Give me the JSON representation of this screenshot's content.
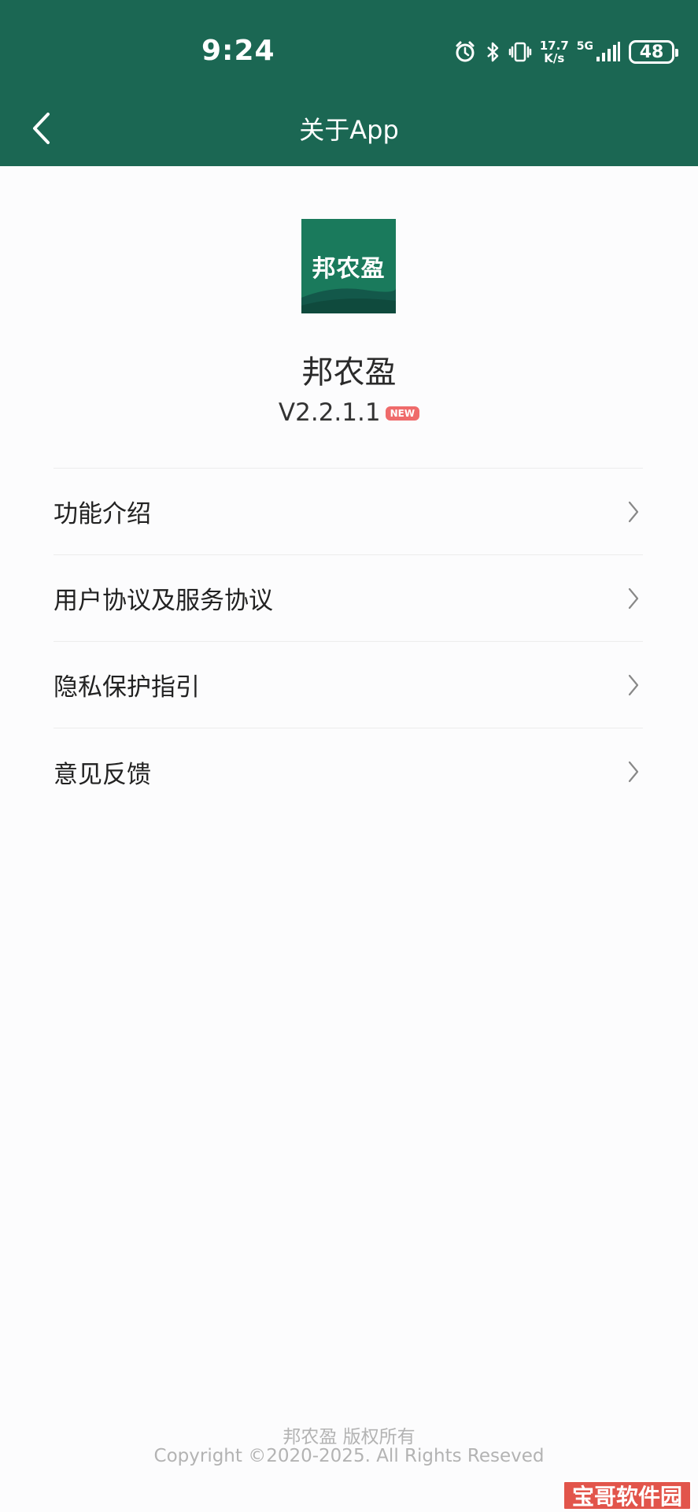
{
  "status_bar": {
    "time": "9:24",
    "speed_value": "17.7",
    "speed_unit": "K/s",
    "network": "5G",
    "battery": "48",
    "icons": [
      "alarm-icon",
      "bluetooth-icon",
      "vibrate-icon",
      "signal-icon"
    ]
  },
  "nav": {
    "title": "关于App",
    "back_icon": "chevron-left-icon"
  },
  "app": {
    "logo_text": "邦农盈",
    "name": "邦农盈",
    "version": "V2.2.1.1",
    "badge": "NEW"
  },
  "menu": {
    "items": [
      {
        "label": "功能介绍"
      },
      {
        "label": "用户协议及服务协议"
      },
      {
        "label": "隐私保护指引"
      },
      {
        "label": "意见反馈"
      }
    ]
  },
  "footer": {
    "line1": "邦农盈 版权所有",
    "line2": "Copyright ©2020-2025. All Rights Reseved"
  },
  "watermark": "宝哥软件园",
  "colors": {
    "header": "#1b6753",
    "logo": "#1a7a5c",
    "badge": "#ef6b6b"
  }
}
